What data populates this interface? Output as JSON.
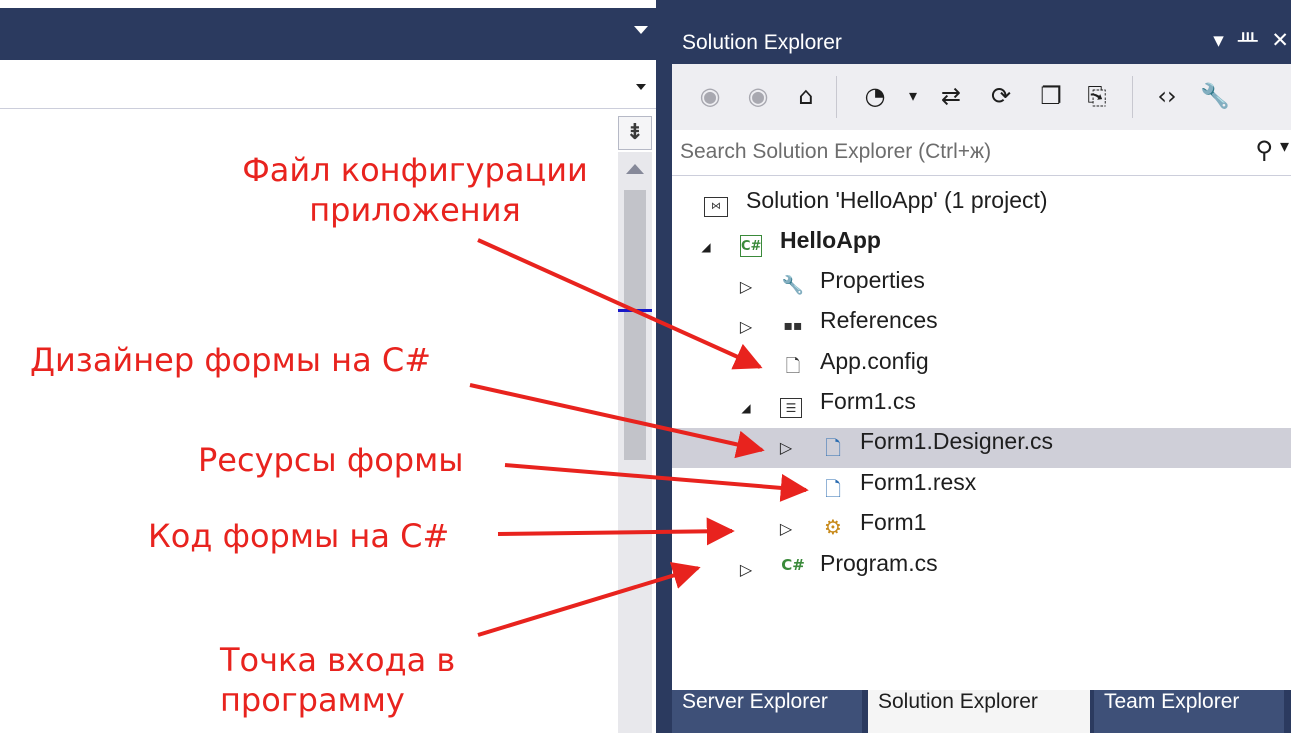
{
  "editor": {
    "split_icon": "split-view-icon"
  },
  "solution_explorer": {
    "title": "Solution Explorer",
    "title_buttons": [
      {
        "icon": "dropdown-icon",
        "glyph": "▾"
      },
      {
        "icon": "pin-icon",
        "glyph": "ᚈ"
      },
      {
        "icon": "close-icon",
        "glyph": "✕"
      }
    ],
    "toolbar": [
      {
        "icon": "back-icon",
        "glyph": "◉",
        "enabled": false
      },
      {
        "icon": "forward-icon",
        "glyph": "◉",
        "enabled": false
      },
      {
        "icon": "home-icon",
        "glyph": "⌂",
        "enabled": true
      },
      {
        "icon": "pending-changes-filter-icon",
        "glyph": "◔",
        "enabled": true
      },
      {
        "icon": "dropdown-icon",
        "glyph": "▾",
        "enabled": true
      },
      {
        "icon": "sync-icon",
        "glyph": "⇄",
        "enabled": true
      },
      {
        "icon": "refresh-icon",
        "glyph": "⟳",
        "enabled": true
      },
      {
        "icon": "collapse-all-icon",
        "glyph": "❐",
        "enabled": true
      },
      {
        "icon": "show-all-files-icon",
        "glyph": "⎘",
        "enabled": true
      },
      {
        "icon": "view-code-icon",
        "glyph": "‹›",
        "enabled": true
      },
      {
        "icon": "properties-icon",
        "glyph": "🔧",
        "enabled": true
      }
    ],
    "search": {
      "placeholder": "Search Solution Explorer (Ctrl+ж)",
      "value": "",
      "icon": "search-icon",
      "dropdown_glyph": "▾"
    },
    "tree": [
      {
        "label": "Solution 'HelloApp' (1 project)",
        "icon": "solution-icon",
        "expander": "",
        "bold": false,
        "selected": false
      },
      {
        "label": "HelloApp",
        "icon": "csharp-project-icon",
        "icon_text": "C#",
        "expander": "◢",
        "bold": true,
        "selected": false
      },
      {
        "label": "Properties",
        "icon": "wrench-icon",
        "expander": "▷",
        "bold": false,
        "selected": false
      },
      {
        "label": "References",
        "icon": "references-icon",
        "expander": "▷",
        "bold": false,
        "selected": false
      },
      {
        "label": "App.config",
        "icon": "config-file-icon",
        "expander": "",
        "bold": false,
        "selected": false
      },
      {
        "label": "Form1.cs",
        "icon": "form-icon",
        "expander": "◢",
        "bold": false,
        "selected": false
      },
      {
        "label": "Form1.Designer.cs",
        "icon": "cs-file-icon",
        "expander": "▷",
        "bold": false,
        "selected": true
      },
      {
        "label": "Form1.resx",
        "icon": "resx-file-icon",
        "expander": "",
        "bold": false,
        "selected": false
      },
      {
        "label": "Form1",
        "icon": "class-icon",
        "expander": "▷",
        "bold": false,
        "selected": false
      },
      {
        "label": "Program.cs",
        "icon": "csharp-file-icon",
        "icon_text": "C#",
        "expander": "▷",
        "bold": false,
        "selected": false
      }
    ],
    "tabs": [
      {
        "label": "Server Explorer",
        "active": false
      },
      {
        "label": "Solution Explorer",
        "active": true
      },
      {
        "label": "Team Explorer",
        "active": false
      }
    ]
  },
  "annotations": {
    "config": "Файл конфигурации\nприложения",
    "designer": "Дизайнер формы на C#",
    "resources": "Ресурсы формы",
    "code": "Код формы на C#",
    "entry": "Точка входа в\nпрограмму",
    "color": "#e8231e"
  },
  "colors": {
    "chrome_dark": "#2b3a5f",
    "selection": "#cfcfd8",
    "toolbar_bg": "#eeeef2",
    "annotation_red": "#e8231e"
  }
}
